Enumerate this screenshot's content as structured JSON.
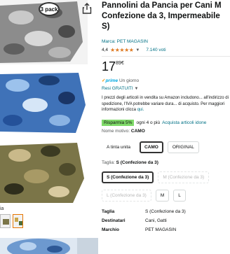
{
  "product": {
    "title_lines": [
      "Pannolini da Pancia per Cani M",
      "Confezione da 3, Impermeabile",
      "S)"
    ],
    "brand": "Marca: PET MAGASIN",
    "rating_value": "4,4",
    "stars": "★★★★★",
    "votes": "7.140 voti",
    "price_main": "17",
    "price_cents": "89€",
    "prime_label": "prime",
    "prime_suffix": "Un giorno",
    "returns": "Resi GRATUITI",
    "info_text": "I prezzi degli articoli in vendita su Amazon includono... all'indirizzo di spedizione, l'IVA potrebbe variare dura... di acquisto. Per maggiori informazioni clicca",
    "info_link": "qui.",
    "savings_badge": "Risparmia 5%",
    "savings_text": "ogni 4 o più",
    "savings_link": "Acquista articoli idone",
    "motif_label": "Nome motivo:",
    "motif_value": "CAMO",
    "motif_options": [
      "A tinta unita",
      "CAMO",
      "ORIGINAL"
    ],
    "size_label": "Taglia:",
    "size_value": "S (Confezione da 3)",
    "size_options_row1": [
      "S (Confezione da 3)",
      "M (Confezione da 3)"
    ],
    "size_options_row2": [
      "L (Confezione da 3)",
      "M",
      "L"
    ]
  },
  "gallery": {
    "pack_badge": "3 pack",
    "caption": "ia"
  },
  "specs": [
    {
      "key": "Taglia",
      "value": "S (Confezione da 3)"
    },
    {
      "key": "Destinatari",
      "value": "Cani, Gatti"
    },
    {
      "key": "Marchio",
      "value": "PET MAGASIN"
    }
  ],
  "colors": {
    "link": "#007185",
    "star": "#de7921",
    "prime": "#00a8e1",
    "savings": "#7fda69"
  }
}
